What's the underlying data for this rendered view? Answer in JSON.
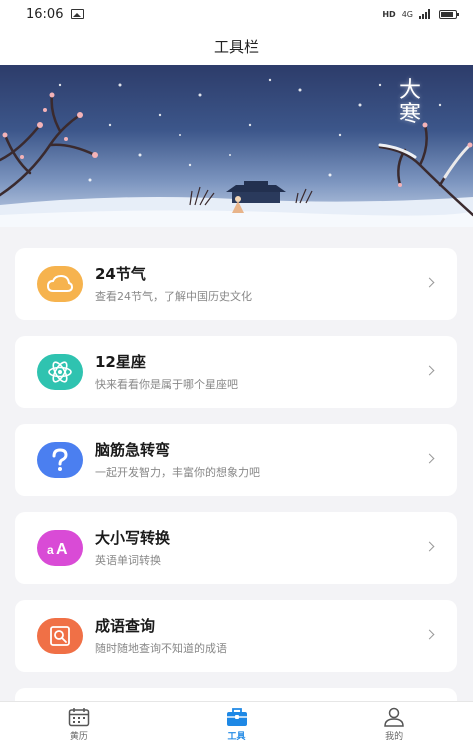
{
  "status_bar": {
    "time": "16:06",
    "hd": "HD",
    "network": "4G"
  },
  "header": {
    "title": "工具栏"
  },
  "banner": {
    "label": "大寒"
  },
  "tools": [
    {
      "title": "24节气",
      "desc": "查看24节气，了解中国历史文化",
      "icon": "cloud-icon",
      "color": "#f5b24a"
    },
    {
      "title": "12星座",
      "desc": "快来看看你是属于哪个星座吧",
      "icon": "atom-icon",
      "color": "#2fc3b0"
    },
    {
      "title": "脑筋急转弯",
      "desc": "一起开发智力，丰富你的想象力吧",
      "icon": "question-icon",
      "color": "#4b7ff0"
    },
    {
      "title": "大小写转换",
      "desc": "英语单词转换",
      "icon": "case-convert-icon",
      "color": "#d94bd6"
    },
    {
      "title": "成语查询",
      "desc": "随时随地查询不知道的成语",
      "icon": "idiom-search-icon",
      "color": "#f07046"
    }
  ],
  "tab_bar": {
    "tabs": [
      {
        "label": "黄历",
        "icon": "calendar-icon"
      },
      {
        "label": "工具",
        "icon": "toolbox-icon",
        "active": true
      },
      {
        "label": "我的",
        "icon": "user-icon"
      }
    ],
    "accent": "#1e88e5"
  }
}
